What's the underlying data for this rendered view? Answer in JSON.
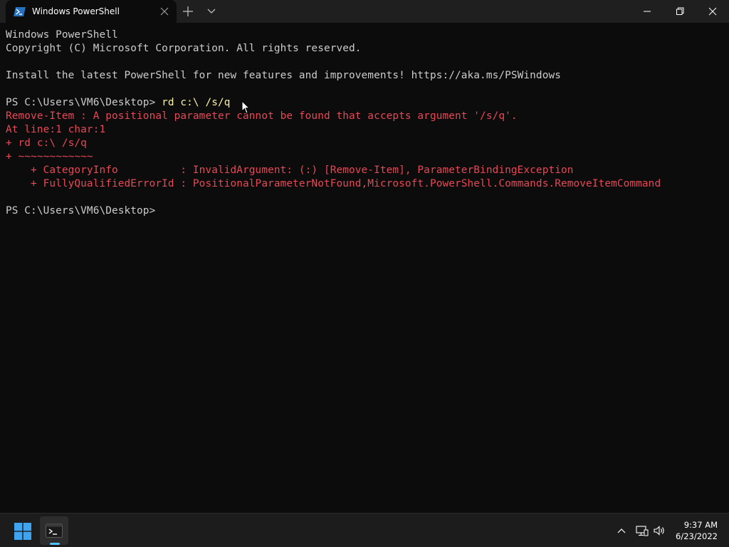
{
  "window": {
    "tab_title": "Windows PowerShell"
  },
  "terminal": {
    "lines": [
      {
        "text": "Windows PowerShell",
        "kind": "normal"
      },
      {
        "text": "Copyright (C) Microsoft Corporation. All rights reserved.",
        "kind": "normal"
      },
      {
        "text": "",
        "kind": "normal"
      },
      {
        "text": "Install the latest PowerShell for new features and improvements! https://aka.ms/PSWindows",
        "kind": "normal"
      },
      {
        "text": "",
        "kind": "normal"
      },
      {
        "prompt": "PS C:\\Users\\VM6\\Desktop> ",
        "command": "rd c:\\ /s/q",
        "kind": "prompt"
      },
      {
        "text": "Remove-Item : A positional parameter cannot be found that accepts argument '/s/q'.",
        "kind": "error"
      },
      {
        "text": "At line:1 char:1",
        "kind": "error"
      },
      {
        "text": "+ rd c:\\ /s/q",
        "kind": "error"
      },
      {
        "text": "+ ~~~~~~~~~~~~",
        "kind": "error"
      },
      {
        "text": "    + CategoryInfo          : InvalidArgument: (:) [Remove-Item], ParameterBindingException",
        "kind": "error"
      },
      {
        "text": "    + FullyQualifiedErrorId : PositionalParameterNotFound,Microsoft.PowerShell.Commands.RemoveItemCommand",
        "kind": "error"
      },
      {
        "text": "",
        "kind": "normal"
      },
      {
        "text": "PS C:\\Users\\VM6\\Desktop>",
        "kind": "normal"
      }
    ]
  },
  "taskbar": {
    "time": "9:37 AM",
    "date": "6/23/2022"
  },
  "colors": {
    "terminal_bg": "#0c0c0c",
    "text": "#cccccc",
    "error": "#e74856",
    "command": "#f9f1a5",
    "accent": "#4cc2ff"
  },
  "icons": [
    "powershell-icon",
    "close-tab-icon",
    "new-tab-icon",
    "dropdown-chevron-icon",
    "minimize-icon",
    "maximize-icon",
    "close-window-icon",
    "windows-start-icon",
    "terminal-app-icon",
    "tray-chevron-icon",
    "network-icon",
    "volume-icon",
    "mouse-cursor-icon"
  ]
}
